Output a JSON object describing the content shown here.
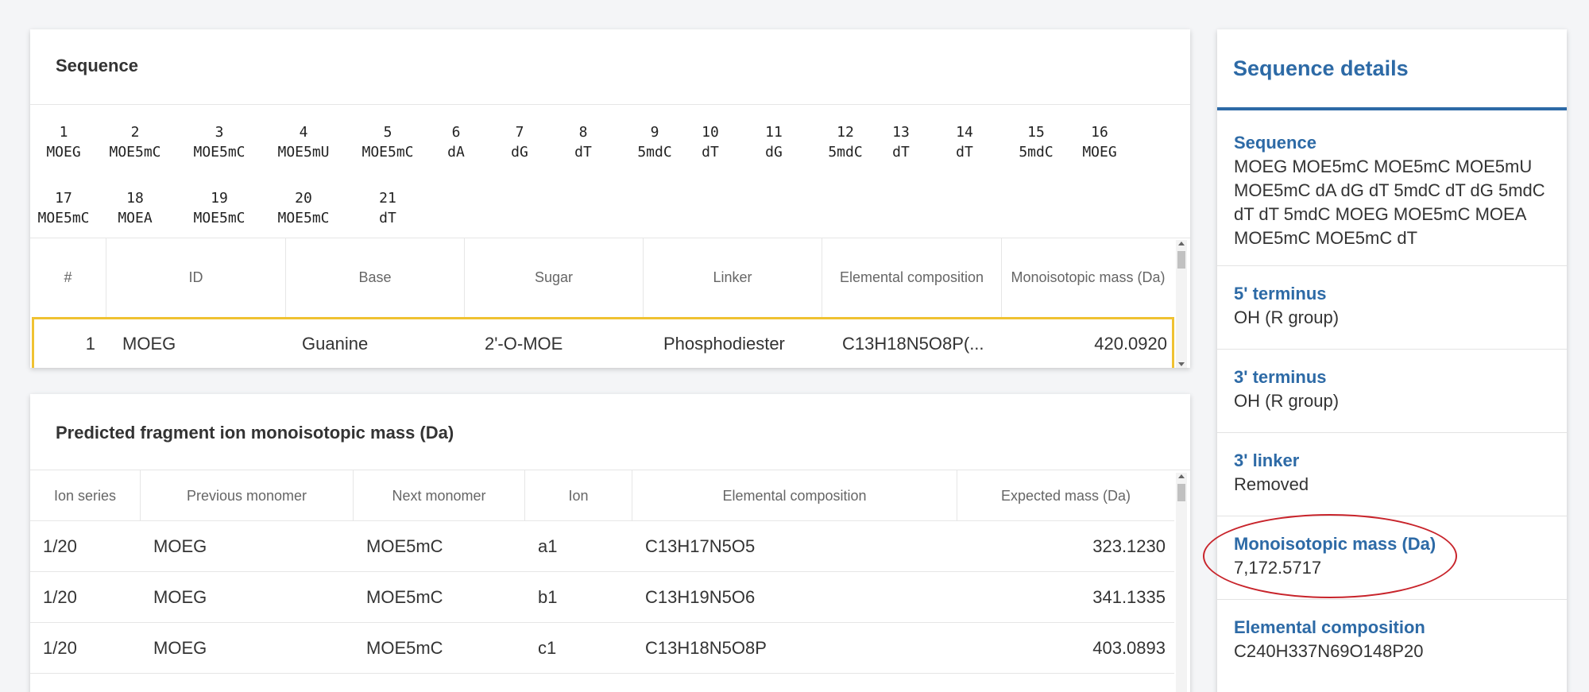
{
  "sequence_card": {
    "title": "Sequence",
    "monomers": [
      {
        "n": "1",
        "code": "MOEG"
      },
      {
        "n": "2",
        "code": "MOE5mC"
      },
      {
        "n": "3",
        "code": "MOE5mC"
      },
      {
        "n": "4",
        "code": "MOE5mU"
      },
      {
        "n": "5",
        "code": "MOE5mC"
      },
      {
        "n": "6",
        "code": "dA"
      },
      {
        "n": "7",
        "code": "dG"
      },
      {
        "n": "8",
        "code": "dT"
      },
      {
        "n": "9",
        "code": "5mdC"
      },
      {
        "n": "10",
        "code": "dT"
      },
      {
        "n": "11",
        "code": "dG"
      },
      {
        "n": "12",
        "code": "5mdC"
      },
      {
        "n": "13",
        "code": "dT"
      },
      {
        "n": "14",
        "code": "dT"
      },
      {
        "n": "15",
        "code": "5mdC"
      },
      {
        "n": "16",
        "code": "MOEG"
      },
      {
        "n": "17",
        "code": "MOE5mC"
      },
      {
        "n": "18",
        "code": "MOEA"
      },
      {
        "n": "19",
        "code": "MOE5mC"
      },
      {
        "n": "20",
        "code": "MOE5mC"
      },
      {
        "n": "21",
        "code": "dT"
      }
    ],
    "table": {
      "headers": [
        "#",
        "ID",
        "Base",
        "Sugar",
        "Linker",
        "Elemental composition",
        "Monoisotopic mass (Da)"
      ],
      "rows": [
        {
          "num": "1",
          "id": "MOEG",
          "base": "Guanine",
          "sugar": "2'-O-MOE",
          "linker": "Phosphodiester",
          "composition": "C13H18N5O8P(...",
          "mass": "420.0920"
        }
      ]
    }
  },
  "fragment_card": {
    "title": "Predicted fragment ion monoisotopic mass (Da)",
    "headers": [
      "Ion series",
      "Previous monomer",
      "Next monomer",
      "Ion",
      "Elemental composition",
      "Expected mass (Da)"
    ],
    "rows": [
      {
        "series": "1/20",
        "prev": "MOEG",
        "next": "MOE5mC",
        "ion": "a1",
        "composition": "C13H17N5O5",
        "mass": "323.1230"
      },
      {
        "series": "1/20",
        "prev": "MOEG",
        "next": "MOE5mC",
        "ion": "b1",
        "composition": "C13H19N5O6",
        "mass": "341.1335"
      },
      {
        "series": "1/20",
        "prev": "MOEG",
        "next": "MOE5mC",
        "ion": "c1",
        "composition": "C13H18N5O8P",
        "mass": "403.0893"
      }
    ]
  },
  "details": {
    "title": "Sequence details",
    "sequence_label": "Sequence",
    "sequence_value": "MOEG MOE5mC MOE5mC MOE5mU MOE5mC dA dG dT 5mdC dT dG 5mdC dT dT 5mdC MOEG MOE5mC MOEA MOE5mC MOE5mC dT",
    "five_prime_label": "5' terminus",
    "five_prime_value": "OH (R group)",
    "three_prime_label": "3' terminus",
    "three_prime_value": "OH (R group)",
    "three_linker_label": "3' linker",
    "three_linker_value": "Removed",
    "mass_label": "Monoisotopic mass (Da)",
    "mass_value": "7,172.5717",
    "composition_label": "Elemental composition",
    "composition_value": "C240H337N69O148P20"
  },
  "colors": {
    "accent": "#2d6aa6",
    "highlight_row": "#f0c232",
    "annotation": "#c8242b"
  }
}
